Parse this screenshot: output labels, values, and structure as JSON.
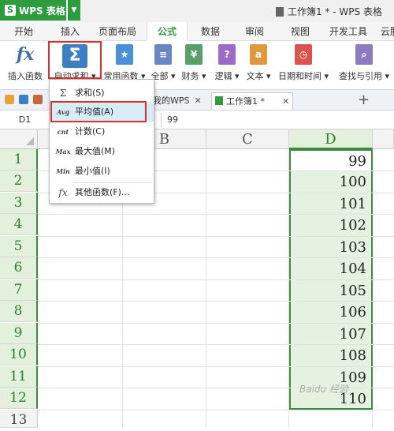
{
  "app": {
    "name": "WPS 表格",
    "doc_title": "工作簿1 * - WPS 表格"
  },
  "tabs": [
    "开始",
    "插入",
    "页面布局",
    "公式",
    "数据",
    "审阅",
    "视图",
    "开发工具",
    "云服"
  ],
  "ribbon": {
    "insert_function": "插入函数",
    "auto_sum": "自动求和",
    "common_functions": "常用函数",
    "all": "全部",
    "finance": "财务",
    "logic": "逻辑",
    "text": "文本",
    "datetime": "日期和时间",
    "lookup": "查找与引用"
  },
  "doc_tabs": {
    "my_wps": "我的WPS",
    "workbook": "工作簿1 *"
  },
  "formula_bar": {
    "cell_ref": "D1",
    "value": "99"
  },
  "columns": [
    "B",
    "C",
    "D"
  ],
  "rows": [
    "1",
    "2",
    "3",
    "4",
    "5",
    "6",
    "7",
    "8",
    "9",
    "10",
    "11",
    "12",
    "13"
  ],
  "column_d_values": [
    "99",
    "100",
    "101",
    "102",
    "103",
    "104",
    "105",
    "106",
    "107",
    "108",
    "109",
    "110"
  ],
  "menu": {
    "sum": {
      "icon": "Σ",
      "label": "求和(S)"
    },
    "average": {
      "icon": "Avg",
      "label": "平均值(A)"
    },
    "count": {
      "icon": "cnt",
      "label": "计数(C)"
    },
    "max": {
      "icon": "Max",
      "label": "最大值(M)"
    },
    "min": {
      "icon": "Min",
      "label": "最小值(I)"
    },
    "other": {
      "icon": "fx",
      "label": "其他函数(F)..."
    }
  },
  "watermark": "Baidu 经验",
  "colors": {
    "brand_green": "#2e9b3e",
    "highlight_red": "#d9322a",
    "selection_green": "#3b8d3b"
  }
}
